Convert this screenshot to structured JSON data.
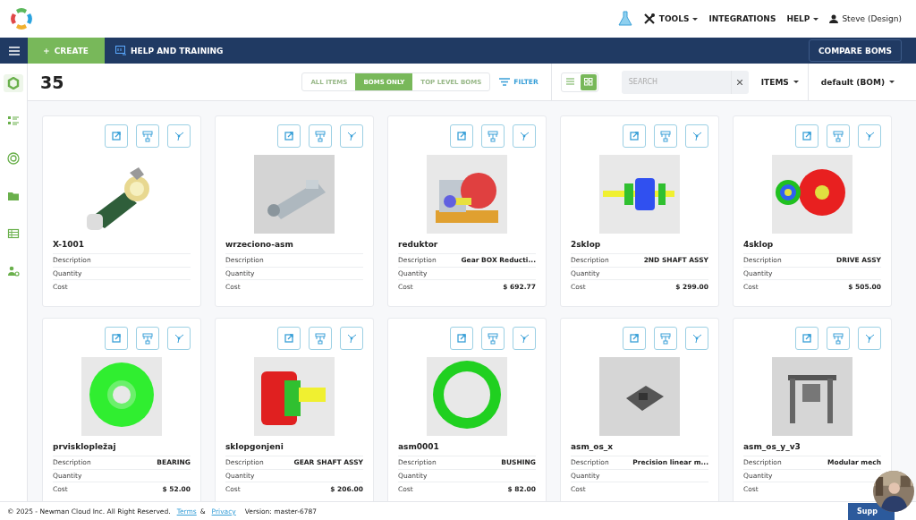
{
  "header": {
    "menus": [
      {
        "kind": "tools",
        "label": "TOOLS",
        "dropdown": true
      },
      {
        "kind": "plain",
        "label": "INTEGRATIONS",
        "dropdown": false
      },
      {
        "kind": "plain",
        "label": "HELP",
        "dropdown": true
      },
      {
        "kind": "user",
        "label": "Steve (Design)",
        "dropdown": false
      }
    ]
  },
  "navbar": {
    "create": "CREATE",
    "help": "HELP AND TRAINING",
    "compare": "COMPARE BOMS"
  },
  "sidebar": {
    "items": [
      {
        "kind": "hexagon",
        "selected": true
      },
      {
        "kind": "list",
        "selected": false
      },
      {
        "kind": "target",
        "selected": false
      },
      {
        "kind": "folder",
        "selected": false
      },
      {
        "kind": "table",
        "selected": false
      },
      {
        "kind": "user-gear",
        "selected": false
      }
    ]
  },
  "toolbar": {
    "count": "35",
    "segments": [
      {
        "label": "ALL ITEMS",
        "selected": false
      },
      {
        "label": "BOMS ONLY",
        "selected": true
      },
      {
        "label": "TOP LEVEL BOMS",
        "selected": false
      }
    ],
    "filter": "FILTER",
    "views": [
      {
        "kind": "list",
        "selected": false
      },
      {
        "kind": "grid",
        "selected": true
      }
    ],
    "search": {
      "placeholder": "SEARCH"
    },
    "items_menu": "ITEMS",
    "bom_menu": "default (BOM)"
  },
  "cards": [
    {
      "name": "X-1001",
      "fields": [
        {
          "label": "Description"
        },
        {
          "label": "Quantity"
        },
        {
          "label": "Cost"
        }
      ]
    },
    {
      "name": "wrzeciono-asm",
      "fields": [
        {
          "label": "Description"
        },
        {
          "label": "Quantity"
        },
        {
          "label": "Cost"
        }
      ]
    },
    {
      "name": "reduktor",
      "fields": [
        {
          "label": "Description",
          "value": "Gear BOX Reducti..."
        },
        {
          "label": "Quantity"
        },
        {
          "label": "Cost",
          "value": "$ 692.77"
        }
      ]
    },
    {
      "name": "2sklop",
      "fields": [
        {
          "label": "Description",
          "value": "2ND SHAFT ASSY"
        },
        {
          "label": "Quantity"
        },
        {
          "label": "Cost",
          "value": "$ 299.00"
        }
      ]
    },
    {
      "name": "4sklop",
      "fields": [
        {
          "label": "Description",
          "value": "DRIVE ASSY"
        },
        {
          "label": "Quantity"
        },
        {
          "label": "Cost",
          "value": "$ 505.00"
        }
      ]
    },
    {
      "name": "prvisklopležaj",
      "fields": [
        {
          "label": "Description",
          "value": "BEARING"
        },
        {
          "label": "Quantity"
        },
        {
          "label": "Cost",
          "value": "$ 52.00"
        }
      ]
    },
    {
      "name": "sklopgonjeni",
      "fields": [
        {
          "label": "Description",
          "value": "GEAR SHAFT ASSY"
        },
        {
          "label": "Quantity"
        },
        {
          "label": "Cost",
          "value": "$ 206.00"
        }
      ]
    },
    {
      "name": "asm0001",
      "fields": [
        {
          "label": "Description",
          "value": "BUSHING"
        },
        {
          "label": "Quantity"
        },
        {
          "label": "Cost",
          "value": "$ 82.00"
        }
      ]
    },
    {
      "name": "asm_os_x",
      "fields": [
        {
          "label": "Description",
          "value": "Precision linear m..."
        },
        {
          "label": "Quantity"
        },
        {
          "label": "Cost"
        }
      ]
    },
    {
      "name": "asm_os_y_v3",
      "fields": [
        {
          "label": "Description",
          "value": "Modular mech"
        },
        {
          "label": "Quantity"
        },
        {
          "label": "Cost"
        }
      ]
    }
  ],
  "footer": {
    "copyright": "© 2025 - Newman Cloud Inc. All Right Reserved.",
    "terms": "Terms",
    "amp": "&",
    "privacy": "Privacy",
    "version": "Version: master-6787",
    "support": "Supp"
  }
}
